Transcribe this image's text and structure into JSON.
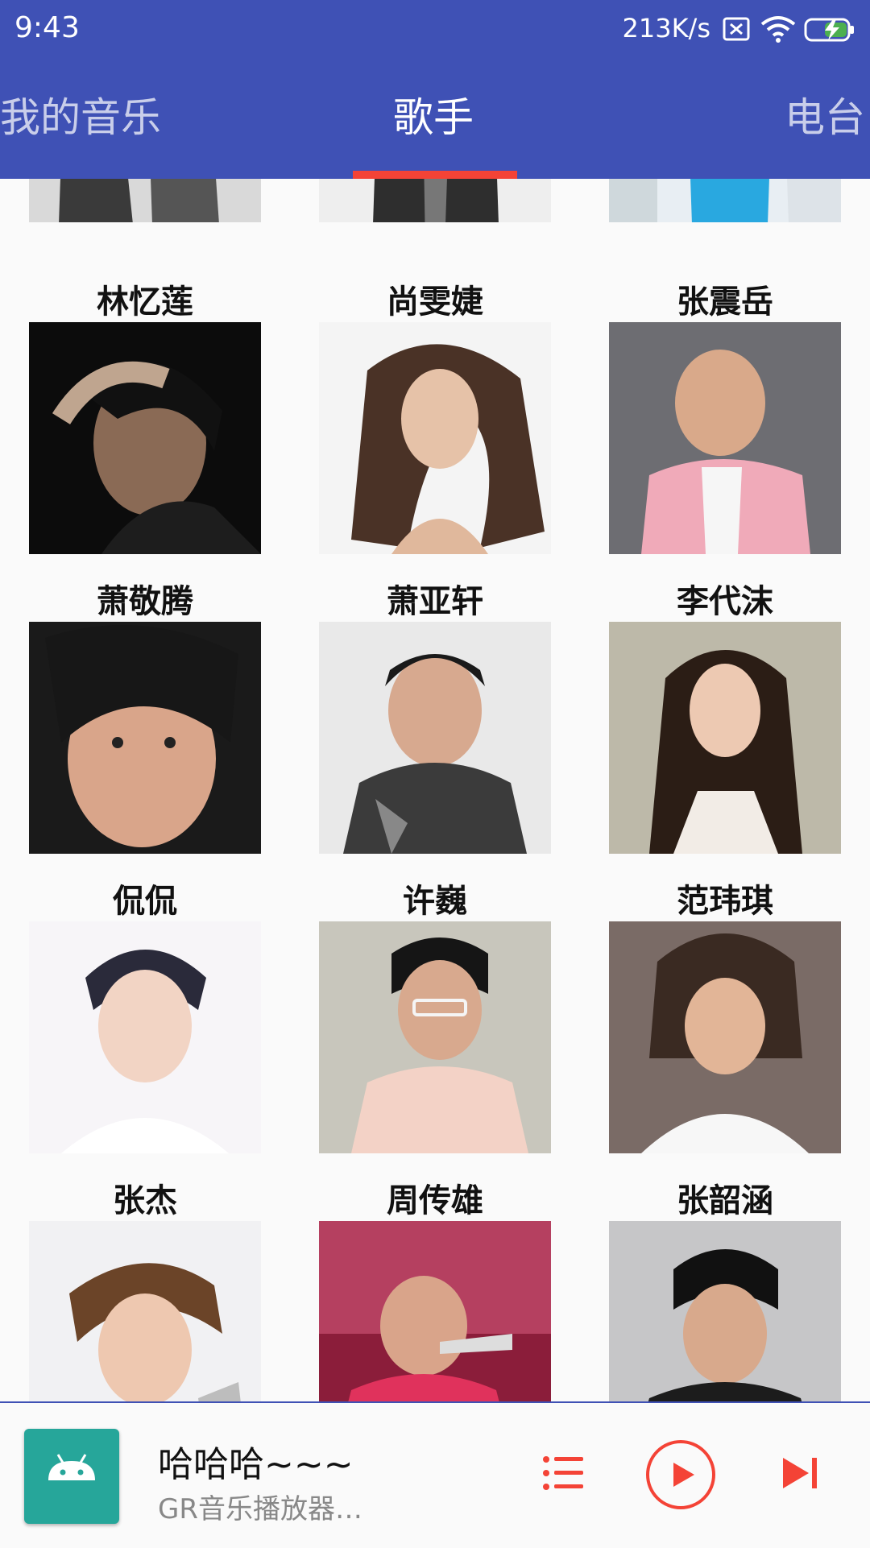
{
  "status_bar": {
    "time": "9:43",
    "net_speed": "213K/s",
    "sim_icon": "sim-error-icon",
    "wifi_icon": "wifi-icon",
    "battery_icon": "battery-charging-icon"
  },
  "tabs": [
    {
      "label": "我的音乐",
      "active": false
    },
    {
      "label": "歌手",
      "active": true
    },
    {
      "label": "电台",
      "active": false
    }
  ],
  "colors": {
    "app_bar": "#3f51b5",
    "tab_indicator": "#f44336",
    "player_accent": "#f44336",
    "album_art_bg": "#26a69a"
  },
  "singers": [
    {
      "name": "林忆莲"
    },
    {
      "name": "尚雯婕"
    },
    {
      "name": "张震岳"
    },
    {
      "name": "萧敬腾"
    },
    {
      "name": "萧亚轩"
    },
    {
      "name": "李代沫"
    },
    {
      "name": "侃侃"
    },
    {
      "name": "许巍"
    },
    {
      "name": "范玮琪"
    },
    {
      "name": "张杰"
    },
    {
      "name": "周传雄"
    },
    {
      "name": "张韶涵"
    }
  ],
  "player": {
    "title": "哈哈哈~~~",
    "subtitle": "GR音乐播放器…",
    "album_icon": "android-robot-icon",
    "list_icon": "playlist-icon",
    "play_icon": "play-circle-icon",
    "next_icon": "skip-next-icon"
  }
}
